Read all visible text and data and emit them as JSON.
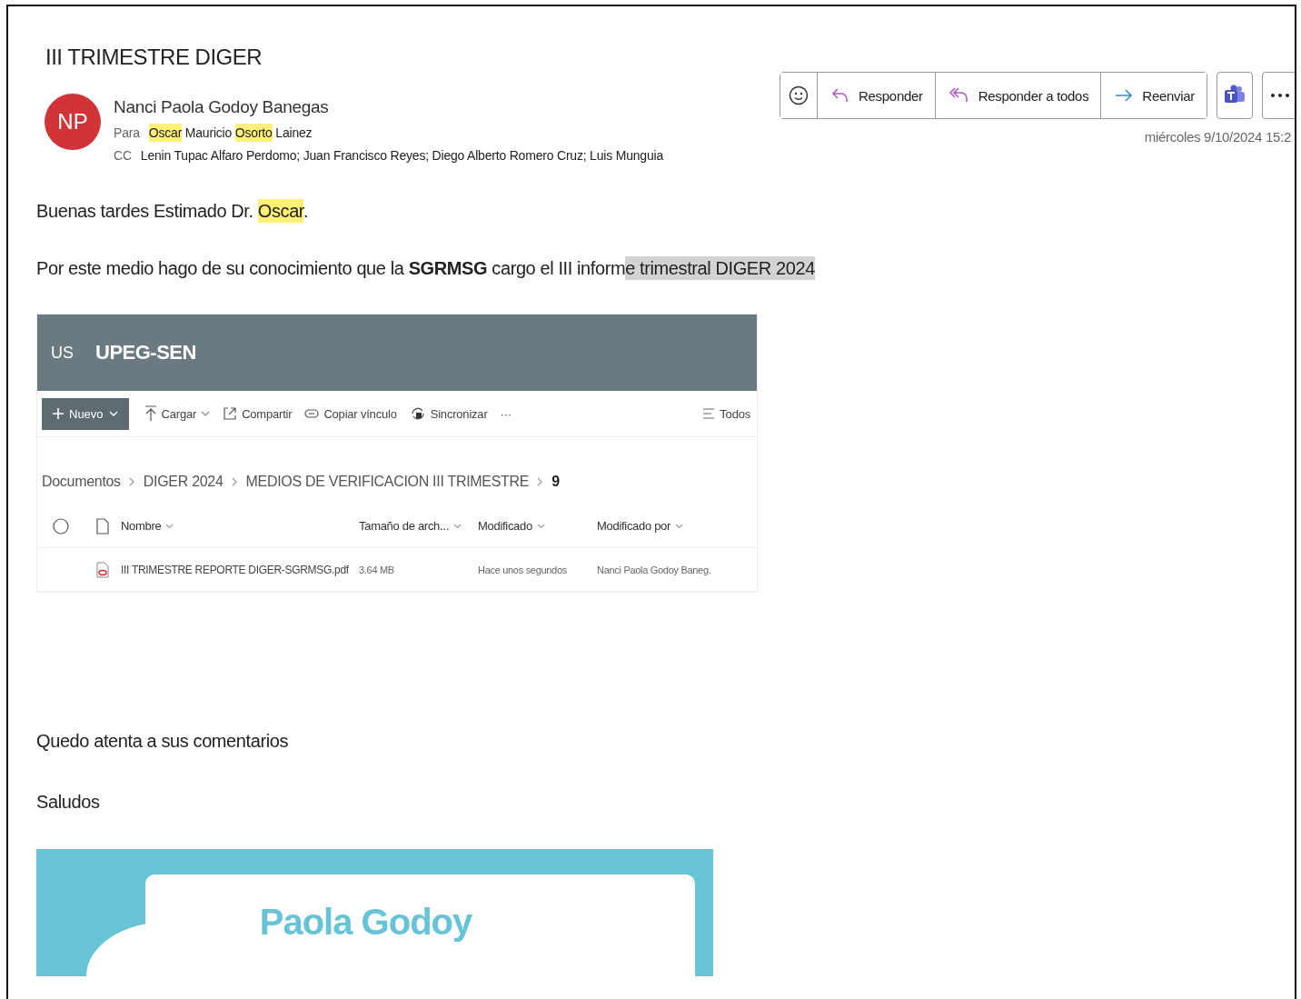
{
  "subject": "III TRIMESTRE DIGER",
  "sender": {
    "initials": "NP",
    "name": "Nanci Paola Godoy Banegas"
  },
  "to": {
    "label": "Para",
    "parts": [
      {
        "text": "Oscar",
        "color": "#fff176"
      },
      {
        "text": " Mauricio "
      },
      {
        "text": "Osorto",
        "color": "#fff176"
      },
      {
        "text": " Lainez"
      }
    ]
  },
  "cc": {
    "label": "CC",
    "value": "Lenin Tupac Alfaro Perdomo; Juan Francisco Reyes; Diego Alberto Romero Cruz; Luis Munguia"
  },
  "actions": [
    {
      "kind": "emoji"
    },
    {
      "kind": "reply",
      "label": "Responder"
    },
    {
      "kind": "reply_all",
      "label": "Responder a todos"
    },
    {
      "kind": "forward",
      "label": "Reenviar"
    }
  ],
  "date": "miércoles 9/10/2024 15:2",
  "body": [
    [
      {
        "text": "Buenas tardes Estimado Dr. "
      },
      {
        "text": "Oscar",
        "color": "#fff176"
      },
      {
        "text": "."
      }
    ],
    [
      {
        "text": "Por este medio hago de su conocimiento que la **SGRMSG** cargo el III inform"
      },
      {
        "text": "e trimestral DIGER 2024",
        "color": "#d3d3d3"
      }
    ]
  ],
  "sharepoint": {
    "site_initials": "US",
    "site_name": "UPEG-SEN",
    "toolbar": [
      {
        "kind": "primary",
        "label": "Nuevo"
      },
      {
        "kind": "upload",
        "label": "Cargar"
      },
      {
        "kind": "share",
        "label": "Compartir"
      },
      {
        "kind": "link",
        "label": "Copiar vínculo"
      },
      {
        "kind": "sync",
        "label": "Sincronizar"
      },
      {
        "kind": "more",
        "label": "···"
      }
    ],
    "view": "Todos",
    "breadcrumb": [
      "Documentos",
      "DIGER 2024",
      "MEDIOS DE VERIFICACION III TRIMESTRE",
      "9"
    ],
    "columns": [
      "Nombre",
      "Tamaño de arch...",
      "Modificado",
      "Modificado por"
    ],
    "rows": [
      {
        "name": "III TRIMESTRE REPORTE DIGER-SGRMSG.pdf",
        "size": "3.64 MB",
        "modified": "Hace unos segundos",
        "modified_by": "Nanci Paola Godoy Baneg."
      }
    ]
  },
  "closing": [
    "Quedo atenta a sus comentarios",
    "Saludos"
  ],
  "signature": {
    "name": "Paola Godoy"
  }
}
